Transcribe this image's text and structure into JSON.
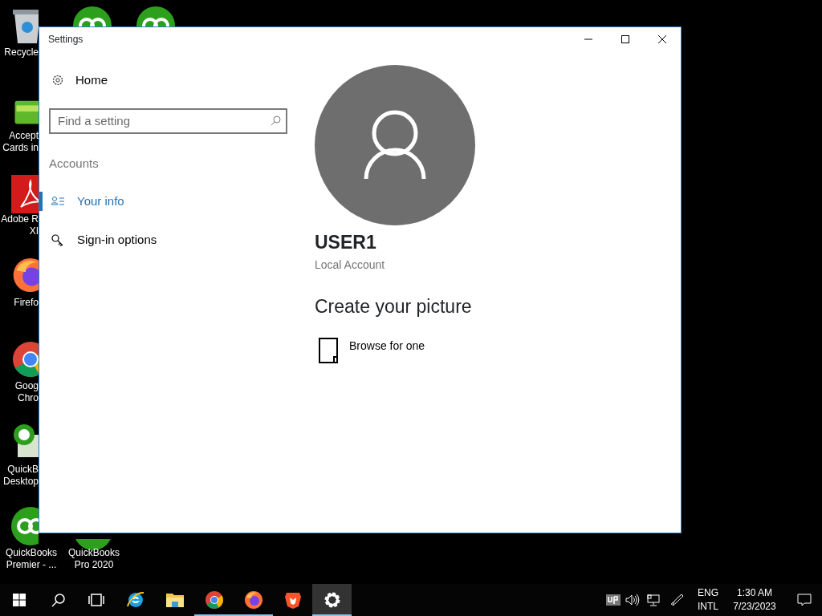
{
  "desktop_icons": [
    {
      "kind": "recycle-bin",
      "lines": [
        "Recycle"
      ]
    },
    {
      "kind": "quickbooks"
    },
    {
      "kind": "quickbooks"
    },
    {
      "kind": "cards",
      "lines": [
        "Accept",
        "Cards in"
      ]
    },
    {
      "kind": "pdf",
      "lines": [
        "Adobe R",
        "XI"
      ]
    },
    {
      "kind": "firefox",
      "lines": [
        "Firefo"
      ]
    },
    {
      "kind": "chrome",
      "lines": [
        "Goog",
        "Chro"
      ]
    },
    {
      "kind": "quickbooks-desktop",
      "lines": [
        "QuickB",
        "Desktop"
      ]
    },
    {
      "kind": "quickbooks",
      "lines": [
        "QuickBooks",
        "Premier - ..."
      ]
    },
    {
      "kind": "quickbooks",
      "lines": [
        "QuickBooks",
        "Pro 2020"
      ]
    }
  ],
  "window": {
    "title": "Settings",
    "sidebar": {
      "home": "Home",
      "search": {
        "placeholder": "Find a setting"
      },
      "section": "Accounts",
      "items": [
        {
          "kind": "person-list",
          "label": "Your info",
          "selected": true
        },
        {
          "kind": "key",
          "label": "Sign-in options",
          "selected": false
        }
      ]
    },
    "content": {
      "user_name": "USER1",
      "account_type": "Local Account",
      "heading": "Create your picture",
      "browse": "Browse for one"
    }
  },
  "taskbar": {
    "apps": [
      {
        "kind": "internet-explorer",
        "running": false,
        "selected": false
      },
      {
        "kind": "folder",
        "running": false,
        "selected": false
      },
      {
        "kind": "chrome",
        "running": true,
        "selected": false
      },
      {
        "kind": "firefox",
        "running": true,
        "selected": false
      },
      {
        "kind": "brave",
        "running": false,
        "selected": false
      },
      {
        "kind": "settings",
        "running": true,
        "selected": true
      }
    ],
    "language": [
      "ENG",
      "INTL"
    ],
    "time": "1:30 AM",
    "date": "7/23/2023"
  }
}
